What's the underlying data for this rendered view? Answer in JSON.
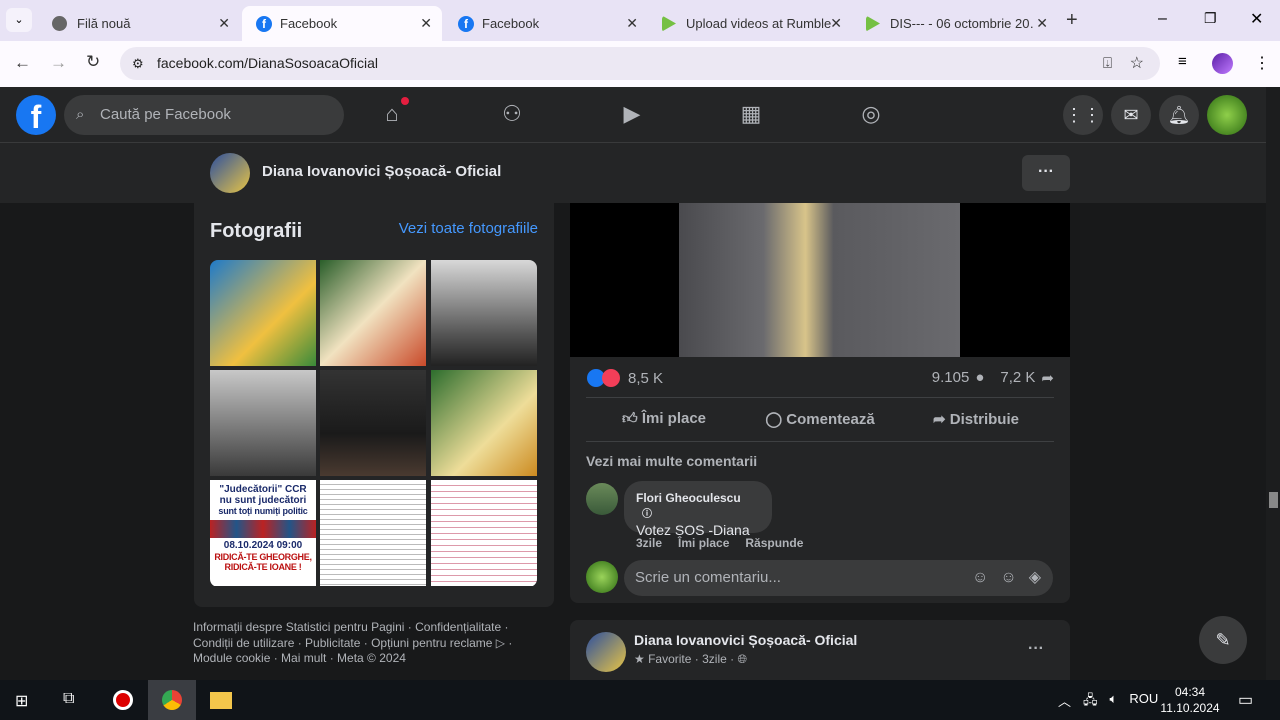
{
  "browser": {
    "tabs": [
      {
        "title": "Filă nouă",
        "icon": "chrome-icon"
      },
      {
        "title": "Facebook",
        "icon": "facebook-icon",
        "active": true
      },
      {
        "title": "Facebook",
        "icon": "facebook-icon"
      },
      {
        "title": "Upload videos at Rumble",
        "icon": "rumble-icon"
      },
      {
        "title": "DIS--- - 06 octombrie 20…",
        "icon": "rumble-icon"
      }
    ],
    "url": "facebook.com/DianaSosoacaOficial"
  },
  "fb": {
    "search_placeholder": "Caută pe Facebook",
    "page_name": "Diana Iovanovici Șoșoacă- Oficial",
    "more": "···"
  },
  "photos": {
    "title": "Fotografii",
    "see_all": "Vezi toate fotografiile",
    "tile7": {
      "line1": "\"Judecătorii\" CCR",
      "line2": "nu sunt judecători",
      "line3": "sunt toți numiți politic",
      "date": "08.10.2024",
      "time": "09:00",
      "slogan1": "RIDICĂ-TE GHEORGHE,",
      "slogan2": "RIDICĂ-TE IOANE !"
    }
  },
  "footer": {
    "line1": "Informații despre Statistici pentru Pagini · Confidențialitate ·",
    "line2": "Condiții de utilizare · Publicitate · Opțiuni pentru reclame ▷ ·",
    "line3": "Module cookie · Mai mult · Meta © 2024"
  },
  "post": {
    "reactions": "8,5 K",
    "comments": "9.105",
    "shares": "7,2 K",
    "like": "Îmi place",
    "comment": "Comentează",
    "share": "Distribuie",
    "more_comments": "Vezi mai multe comentarii",
    "comment_item": {
      "author": "Flori Gheoculescu",
      "text": "Votez SOS -Diana",
      "time": "3zile",
      "like": "Îmi place",
      "reply": "Răspunde"
    },
    "input_placeholder": "Scrie un comentariu..."
  },
  "next_post": {
    "author": "Diana Iovanovici Șoșoacă- Oficial",
    "meta": "Favorite · 3zile ·",
    "more": "···"
  },
  "taskbar": {
    "lang": "ROU",
    "time": "04:34",
    "date": "11.10.2024"
  }
}
